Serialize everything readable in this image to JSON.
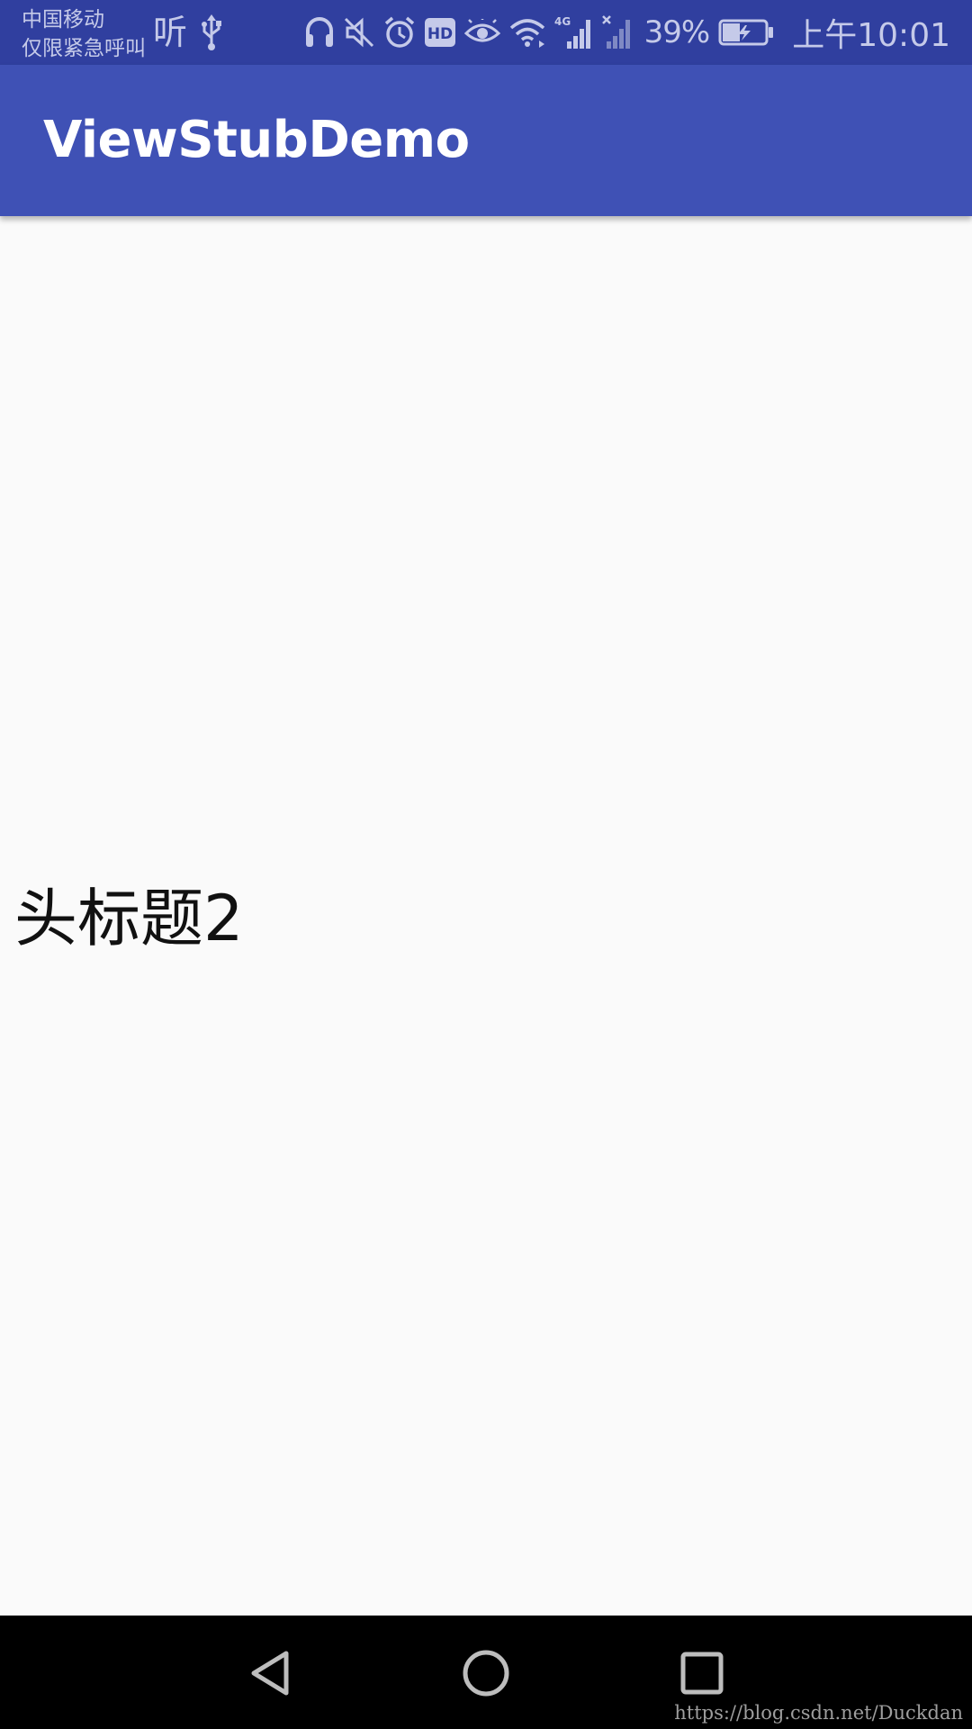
{
  "status_bar": {
    "carrier_line1": "中国移动",
    "carrier_line2": "仅限紧急呼叫",
    "hd_label": "HD",
    "network_label": "4G",
    "battery_percent": "39%",
    "time": "上午10:01",
    "ting_label": "听",
    "icons": [
      "ting-icon",
      "usb-icon",
      "headset-icon",
      "mute-icon",
      "alarm-icon",
      "hd-icon",
      "eye-comfort-icon",
      "wifi-icon",
      "signal-4g-icon",
      "signal-no-sim-icon",
      "battery-charging-icon"
    ]
  },
  "app_bar": {
    "title": "ViewStubDemo"
  },
  "content": {
    "stub_title": "头标题2"
  },
  "nav_bar": {
    "back_icon": "back-triangle-icon",
    "home_icon": "home-circle-icon",
    "recents_icon": "recents-square-icon"
  },
  "watermark": "https://blog.csdn.net/Duckdan",
  "colors": {
    "status_bar": "#303f9f",
    "app_bar": "#3f51b5",
    "background": "#fafafa",
    "nav_bar": "#000000"
  }
}
